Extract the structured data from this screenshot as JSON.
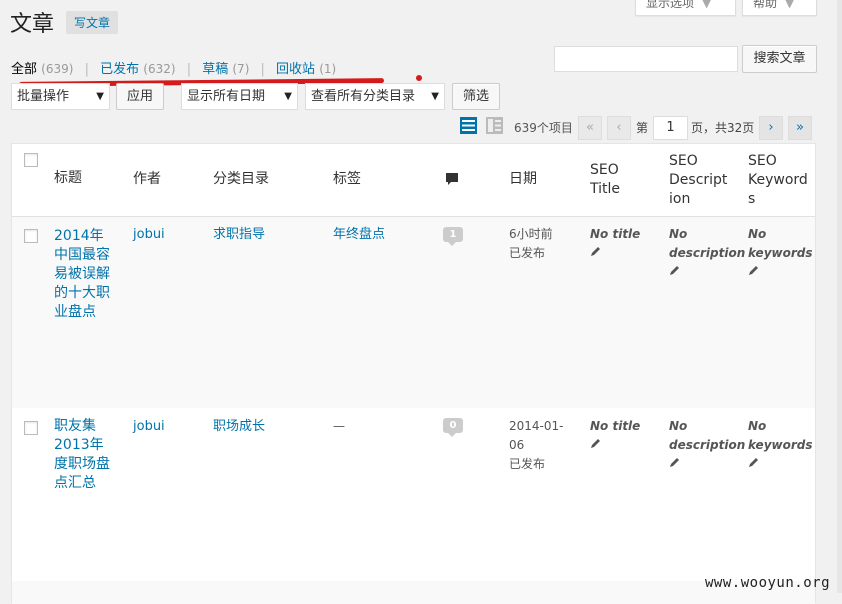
{
  "header": {
    "title": "文章",
    "add_new": "写文章",
    "screen_options": "显示选项",
    "help": "帮助"
  },
  "views": {
    "all": {
      "label": "全部",
      "count": "(639)"
    },
    "published": {
      "label": "已发布",
      "count": "(632)"
    },
    "drafts": {
      "label": "草稿",
      "count": "(7)"
    },
    "trash": {
      "label": "回收站",
      "count": "(1)"
    },
    "separator": "|"
  },
  "search": {
    "button": "搜索文章",
    "value": ""
  },
  "filters": {
    "bulk_action": "批量操作",
    "apply": "应用",
    "dates": "显示所有日期",
    "categories": "查看所有分类目录",
    "filter": "筛选"
  },
  "pagination": {
    "items": "639个项目",
    "first": "«",
    "prev": "‹",
    "page_prefix": "第",
    "current_page": "1",
    "page_suffix": "页，共32页",
    "next": "›",
    "last": "»"
  },
  "columns": {
    "title": "标题",
    "author": "作者",
    "categories": "分类目录",
    "tags": "标签",
    "date": "日期",
    "seo_title": [
      "SEO",
      "Title"
    ],
    "seo_desc": [
      "SEO",
      "Descript",
      "ion"
    ],
    "seo_keywords": [
      "SEO",
      "Keyword",
      "s"
    ]
  },
  "rows": [
    {
      "title_lines": [
        "2014年",
        "中国最容",
        "易被误解",
        "的十大职",
        "业盘点"
      ],
      "author": "jobui",
      "category": "求职指导",
      "tag": "年终盘点",
      "comments": "1",
      "date_lines": [
        "6小时前",
        "已发布"
      ],
      "seo_title": [
        "No title"
      ],
      "seo_desc": [
        "No",
        "description"
      ],
      "seo_keywords": [
        "No",
        "keywords"
      ]
    },
    {
      "title_lines": [
        "职友集",
        "2013年",
        "度职场盘",
        "点汇总"
      ],
      "author": "jobui",
      "category": "职场成长",
      "tag": "—",
      "comments": "0",
      "date_lines": [
        "2014-01-",
        "06",
        "已发布"
      ],
      "seo_title": [
        "No title"
      ],
      "seo_desc": [
        "No",
        "description"
      ],
      "seo_keywords": [
        "No",
        "keywords"
      ]
    }
  ],
  "colors": {
    "link": "#0073aa",
    "highlight": "#d41b1b"
  },
  "watermark": "www.wooyun.org"
}
